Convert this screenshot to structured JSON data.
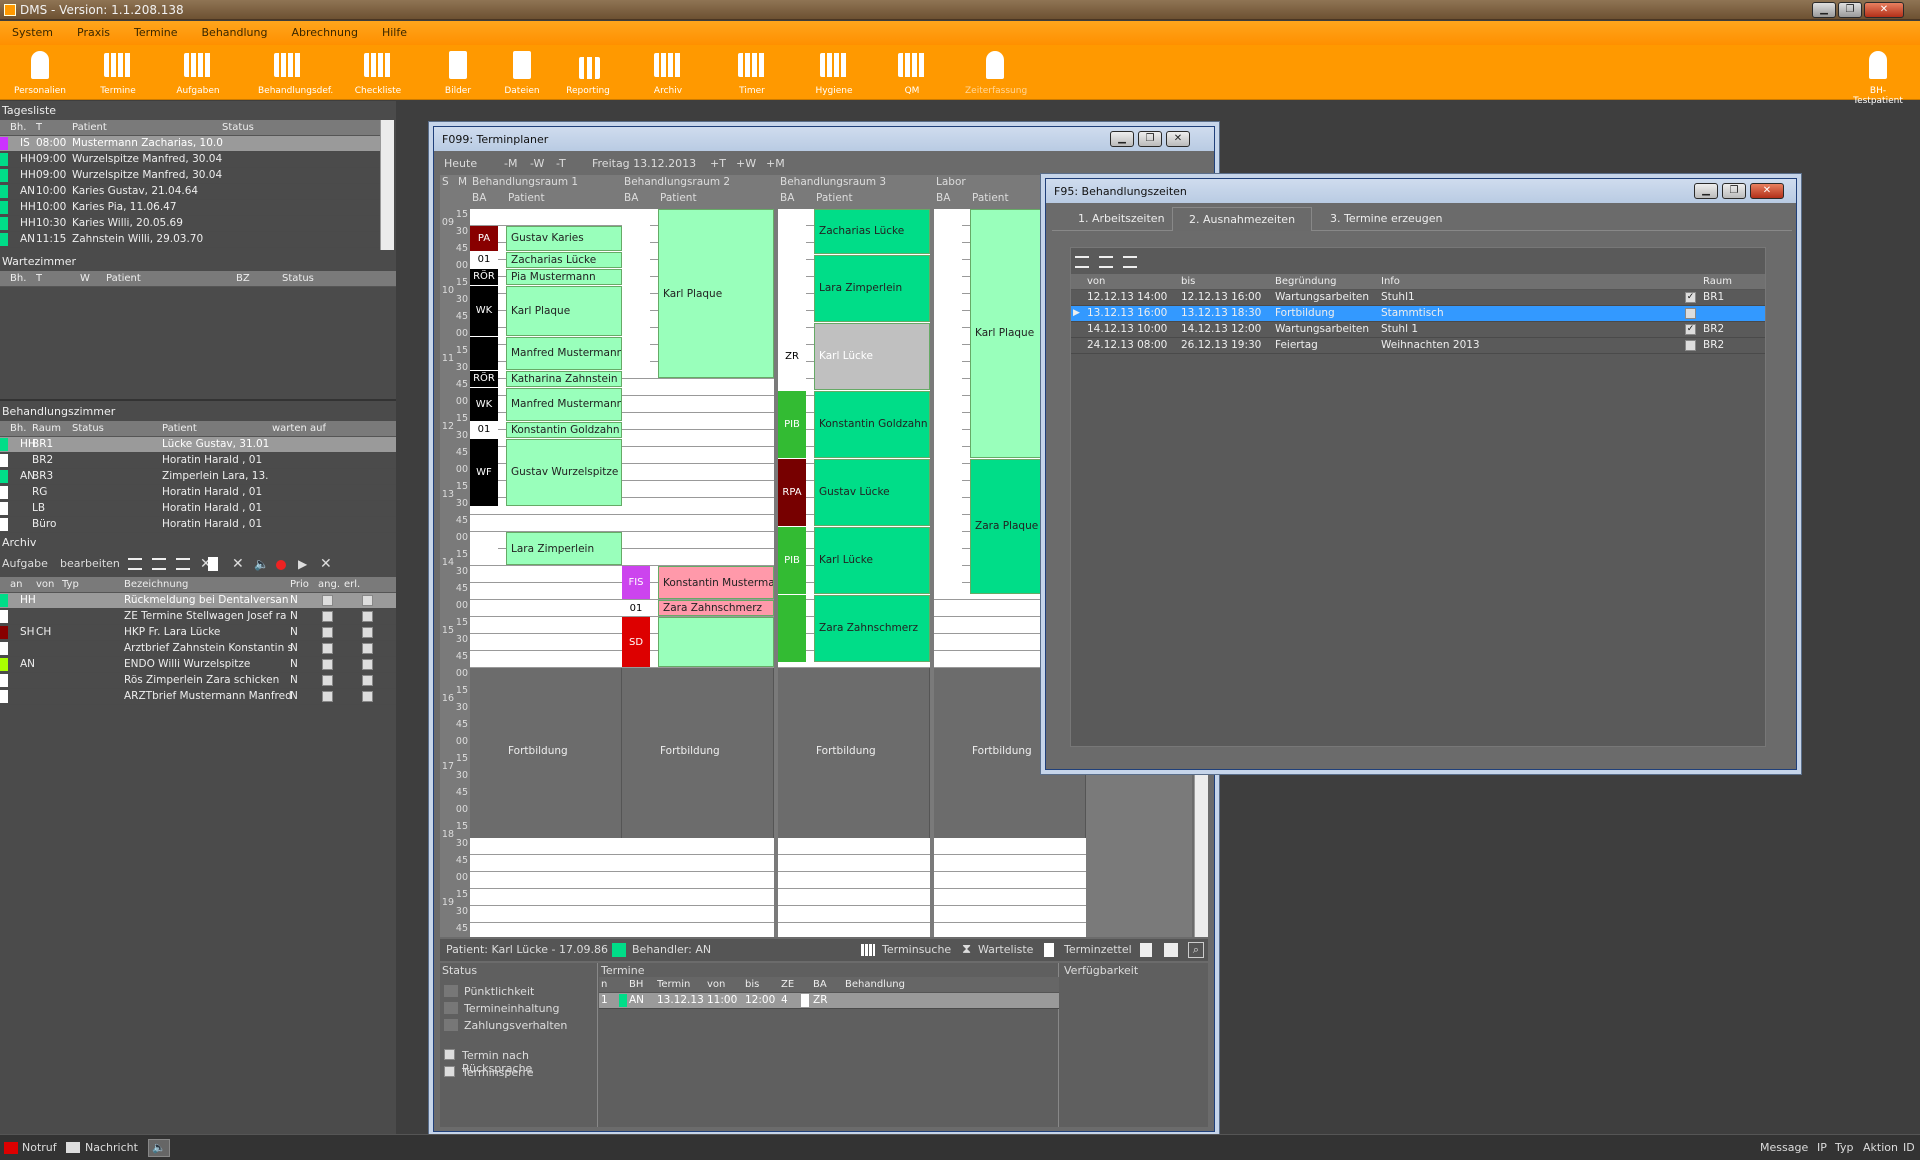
{
  "app": {
    "title": "DMS  -  Version: 1.1.208.138",
    "minimize": "▁",
    "restore": "❐",
    "close": "✕"
  },
  "menu": [
    "System",
    "Praxis",
    "Termine",
    "Behandlung",
    "Abrechnung",
    "Hilfe"
  ],
  "toolbar": [
    "Personalien",
    "Termine",
    "Aufgaben",
    "Behandlungsdef.",
    "Checkliste",
    "Bilder",
    "Dateien",
    "Reporting",
    "Archiv",
    "Timer",
    "Hygiene",
    "QM",
    "Zeiterfassung",
    "BH-Testpatient"
  ],
  "tagesliste": {
    "title": "Tagesliste",
    "cols": [
      "Bh.",
      "T",
      "Patient",
      "Status"
    ],
    "rows": [
      [
        "IS",
        "08:00",
        "Mustermann Zacharias, 10.0",
        ""
      ],
      [
        "HH",
        "09:00",
        "Wurzelspitze Manfred, 30.04",
        ""
      ],
      [
        "HH",
        "09:00",
        "Wurzelspitze Manfred, 30.04",
        ""
      ],
      [
        "AN",
        "10:00",
        "Karies Gustav, 21.04.64",
        ""
      ],
      [
        "HH",
        "10:00",
        "Karies Pia, 11.06.47",
        ""
      ],
      [
        "HH",
        "10:30",
        "Karies Willi, 20.05.69",
        ""
      ],
      [
        "AN",
        "11:15",
        "Zahnstein Willi, 29.03.70",
        ""
      ]
    ],
    "chips": [
      "#cc33ff",
      "#00dd88",
      "#00dd88",
      "#00dd88",
      "#00dd88",
      "#00dd88",
      "#00dd88"
    ]
  },
  "wartezimmer": {
    "title": "Wartezimmer",
    "cols": [
      "Bh.",
      "T",
      "W",
      "Patient",
      "BZ",
      "Status"
    ]
  },
  "behandlungszimmer": {
    "title": "Behandlungszimmer",
    "cols": [
      "Bh.",
      "Raum",
      "Status",
      "Patient",
      "warten auf"
    ],
    "rows": [
      [
        "HH",
        "BR1",
        "",
        "Lücke Gustav, 31.01",
        ""
      ],
      [
        "",
        "BR2",
        "",
        "Horatin Harald   , 01",
        ""
      ],
      [
        "AN",
        "BR3",
        "",
        "Zimperlein Lara, 13.",
        ""
      ],
      [
        "",
        "RG",
        "",
        "Horatin Harald   , 01",
        ""
      ],
      [
        "",
        "LB",
        "",
        "Horatin Harald   , 01",
        ""
      ],
      [
        "",
        "Büro",
        "",
        "Horatin Harald   , 01",
        ""
      ]
    ],
    "chips": [
      "#00dd88",
      "#ffffff",
      "#00dd88",
      "#ffffff",
      "#ffffff",
      "#ffffff"
    ]
  },
  "archiv": {
    "title": "Archiv",
    "btn_aufgabe": "Aufgabe",
    "btn_bearbeiten": "bearbeiten",
    "cols": [
      "an",
      "von",
      "Typ",
      "Bezeichnung",
      "Prio",
      "ang.",
      "erl."
    ],
    "rows": [
      [
        "HH",
        "",
        "",
        "Rückmeldung bei Dentalversan",
        "N"
      ],
      [
        "",
        "",
        "",
        "ZE Termine Stellwagen Josef ra",
        "N"
      ],
      [
        "SH",
        "CH",
        "",
        "HKP Fr. Lara Lücke",
        "N"
      ],
      [
        "",
        "",
        "",
        "Arztbrief Zahnstein Konstantin s",
        "N"
      ],
      [
        "AN",
        "",
        "",
        "ENDO Willi Wurzelspitze",
        "N"
      ],
      [
        "",
        "",
        "",
        "Rös Zimperlein Zara schicken",
        "N"
      ],
      [
        "",
        "",
        "",
        "ARZTbrief Mustermann Manfred",
        "N"
      ]
    ],
    "chips": [
      "#00dd88",
      "#ffffff",
      "#880000",
      "#ffffff",
      "#aaff00",
      "#ffffff",
      "#ffffff"
    ]
  },
  "planner": {
    "title": "F099: Terminplaner",
    "nav": [
      "Heute",
      "-M",
      "-W",
      "-T",
      "Freitag 13.12.2013",
      "+T",
      "+W",
      "+M"
    ],
    "rooms": [
      "Behandlungsraum 1",
      "Behandlungsraum 2",
      "Behandlungsraum 3",
      "Labor"
    ],
    "sub_ba": "BA",
    "sub_patient": "Patient",
    "col_s": "S",
    "col_m": "M",
    "hours": [
      "09",
      "10",
      "11",
      "12",
      "13",
      "14",
      "15",
      "16",
      "17",
      "18",
      "19"
    ],
    "minutes": [
      "00",
      "15",
      "30",
      "45"
    ],
    "appts": [
      {
        "col": 0,
        "start": 1,
        "len": 1.5,
        "text": "Gustav Karies",
        "ba": "PA",
        "bac": "#880000"
      },
      {
        "col": 0,
        "start": 2.5,
        "len": 1,
        "text": "Zacharias Lücke",
        "ba": "01",
        "bac": "#ffffff"
      },
      {
        "col": 0,
        "start": 3.5,
        "len": 1,
        "text": "Pia Mustermann",
        "ba": "RÖR",
        "bac": "#000000"
      },
      {
        "col": 0,
        "start": 4.5,
        "len": 3,
        "text": "Karl Plaque",
        "ba": "WK",
        "bac": "#000000"
      },
      {
        "col": 0,
        "start": 7.5,
        "len": 2,
        "text": "Manfred Mustermann",
        "ba": "",
        "bac": "#000000"
      },
      {
        "col": 0,
        "start": 9.5,
        "len": 1,
        "text": "Katharina Zahnstein",
        "ba": "RÖR",
        "bac": "#000000"
      },
      {
        "col": 0,
        "start": 10.5,
        "len": 2,
        "text": "Manfred Mustermann",
        "ba": "WK",
        "bac": "#000000"
      },
      {
        "col": 0,
        "start": 12.5,
        "len": 1,
        "text": "Konstantin Goldzahn",
        "ba": "01",
        "bac": "#ffffff"
      },
      {
        "col": 0,
        "start": 13.5,
        "len": 4,
        "text": "Gustav Wurzelspitze",
        "ba": "WF",
        "bac": "#000000"
      },
      {
        "col": 0,
        "start": 19,
        "len": 2,
        "text": "Lara Zimperlein",
        "ba": "",
        "bac": "#ffffff"
      },
      {
        "col": 1,
        "start": 0,
        "len": 10,
        "text": "Karl Plaque",
        "ba": "",
        "bac": "#ffffff"
      },
      {
        "col": 1,
        "start": 21,
        "len": 2,
        "text": "Konstantin Musterman",
        "ba": "FIS",
        "bac": "#cc44ee",
        "pink": true
      },
      {
        "col": 1,
        "start": 23,
        "len": 1,
        "text": "Zara Zahnschmerz",
        "ba": "01",
        "bac": "#ffffff",
        "pink": true
      },
      {
        "col": 1,
        "start": 24,
        "len": 3,
        "text": "",
        "ba": "SD",
        "bac": "#dd0000"
      },
      {
        "col": 2,
        "start": 0,
        "len": 2.7,
        "text": "Zacharias Lücke",
        "ba": "",
        "bac": "#ffffff",
        "teal": true
      },
      {
        "col": 2,
        "start": 2.7,
        "len": 4,
        "text": "Lara Zimperlein",
        "ba": "",
        "bac": "#ffffff",
        "teal": true
      },
      {
        "col": 2,
        "start": 6.7,
        "len": 4,
        "text": "Karl Lücke",
        "ba": "ZR",
        "bac": "#ffffff",
        "gray": true
      },
      {
        "col": 2,
        "start": 10.7,
        "len": 4,
        "text": "Konstantin Goldzahn",
        "ba": "PIB",
        "bac": "#33bb33",
        "teal": true
      },
      {
        "col": 2,
        "start": 14.7,
        "len": 4,
        "text": "Gustav Lücke",
        "ba": "RPA",
        "bac": "#770000",
        "teal": true
      },
      {
        "col": 2,
        "start": 18.7,
        "len": 4,
        "text": "Karl Lücke",
        "ba": "PIB",
        "bac": "#33bb33",
        "teal": true
      },
      {
        "col": 2,
        "start": 22.7,
        "len": 4,
        "text": "Zara Zahnschmerz",
        "ba": "",
        "bac": "#33bb33",
        "teal": true
      },
      {
        "col": 3,
        "start": 0,
        "len": 14.7,
        "text": "Karl Plaque",
        "ba": "",
        "bac": "#ffffff"
      },
      {
        "col": 3,
        "start": 14.7,
        "len": 8,
        "text": "Zara Plaque",
        "ba": "",
        "bac": "#ffffff",
        "teal": true
      }
    ],
    "fortbildung": "Fortbildung",
    "bottom": {
      "patient": "Patient: Karl Lücke - 17.09.86",
      "behandler": "Behandler: AN",
      "terminsuche": "Terminsuche",
      "warteliste": "Warteliste",
      "terminzettel": "Terminzettel",
      "status_title": "Status",
      "termine_title": "Termine",
      "verf_title": "Verfügbarkeit",
      "status_items": [
        "Pünktlichkeit",
        "Termineinhaltung",
        "Zahlungsverhalten"
      ],
      "checks": [
        "Termin nach Rücksprache",
        "Terminsperre"
      ],
      "termine_cols": [
        "n",
        "BH",
        "Termin",
        "von",
        "bis",
        "ZE",
        "BA",
        "Behandlung"
      ],
      "termine_row": [
        "1",
        "AN",
        "13.12.13",
        "11:00",
        "12:00",
        "4",
        "ZR",
        ""
      ]
    }
  },
  "bz": {
    "title": "F95: Behandlungszeiten",
    "tabs": [
      "1. Arbeitszeiten",
      "2. Ausnahmezeiten",
      "3. Termine erzeugen"
    ],
    "cols": [
      "von",
      "bis",
      "Begründung",
      "Info",
      "Raum"
    ],
    "rows": [
      [
        "12.12.13 14:00",
        "12.12.13 16:00",
        "Wartungsarbeiten",
        "Stuhl1",
        true,
        "BR1"
      ],
      [
        "13.12.13 16:00",
        "13.12.13 18:30",
        "Fortbildung",
        "Stammtisch",
        false,
        ""
      ],
      [
        "14.12.13 10:00",
        "14.12.13 12:00",
        "Wartungsarbeiten",
        "Stuhl 1",
        true,
        "BR2"
      ],
      [
        "24.12.13 08:00",
        "26.12.13 19:30",
        "Feiertag",
        "Weihnachten 2013",
        false,
        "BR2"
      ]
    ]
  },
  "statusbar": {
    "notruf": "Notruf",
    "nachricht": "Nachricht",
    "message": "Message",
    "ip": "IP",
    "typ": "Typ",
    "aktion": "Aktion",
    "id": "ID"
  },
  "colors": {
    "orange": "#ff9900",
    "green": "#99ffbb",
    "teal": "#00dd88",
    "pink": "#ff99aa",
    "select": "#3399ff"
  }
}
